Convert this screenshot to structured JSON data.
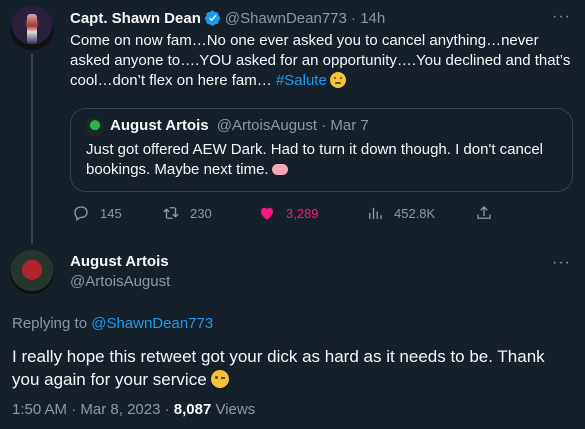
{
  "tweet": {
    "author_name": "Capt. Shawn Dean",
    "author_handle": "@ShawnDean773",
    "time_sep": " · ",
    "time": "14h",
    "text_lines": [
      "Come on now fam…No one ever asked you to cancel anything…never",
      "asked anyone to….YOU asked for an opportunity….You declined and that’s",
      "cool…don’t flex on here fam… "
    ],
    "hashtag": "#Salute",
    "quote": {
      "author_name": "August Artois",
      "author_handle": "@ArtoisAugust",
      "time_sep": " · ",
      "time": "Mar 7",
      "text_lines": [
        "Just got offered AEW Dark. Had to turn it down though. I don't cancel",
        "bookings. Maybe next time."
      ]
    },
    "actions": {
      "replies": "145",
      "retweets": "230",
      "likes": "3,289",
      "views": "452.8K"
    },
    "more_label": "···"
  },
  "reply": {
    "author_name": "August Artois",
    "author_handle": "@ArtoisAugust",
    "replying_prefix": "Replying to ",
    "replying_to": "@ShawnDean773",
    "text_lines": [
      "I really hope this retweet got your dick as hard as it needs to be. Thank",
      "you again for your service"
    ],
    "time": "1:50 AM",
    "date_sep": " · ",
    "date": "Mar 8, 2023",
    "views_sep": " · ",
    "views_count": "8,087",
    "views_label": " Views",
    "more_label": "···"
  },
  "colors": {
    "background": "#15202b",
    "accent": "#1d9bf0",
    "like": "#f91880",
    "muted": "#8b98a5"
  }
}
